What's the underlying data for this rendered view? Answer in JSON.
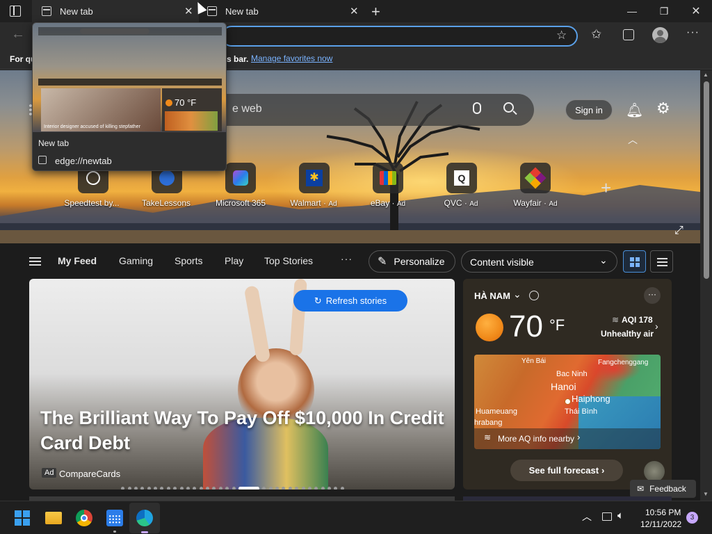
{
  "tabs": [
    {
      "label": "New tab"
    },
    {
      "label": "New tab"
    }
  ],
  "favorites_bar": {
    "prefix": "For qu",
    "suffix": "s bar.",
    "link": "Manage favorites now"
  },
  "tab_preview": {
    "title": "New tab",
    "url": "edge://newtab",
    "thumb_caption": "Interior designer accused of killing stepfather",
    "thumb_temp": "70 °F"
  },
  "search": {
    "placeholder_visible": "e web"
  },
  "header": {
    "sign_in": "Sign in"
  },
  "quick_links": [
    {
      "label": "Speedtest by...",
      "ad": ""
    },
    {
      "label": "TakeLessons",
      "ad": ""
    },
    {
      "label": "Microsoft 365",
      "ad": ""
    },
    {
      "label": "Walmart",
      "ad": "Ad"
    },
    {
      "label": "eBay",
      "ad": "Ad"
    },
    {
      "label": "QVC",
      "ad": "Ad"
    },
    {
      "label": "Wayfair",
      "ad": "Ad"
    }
  ],
  "feed_nav": {
    "items": [
      "My Feed",
      "Gaming",
      "Sports",
      "Play",
      "Top Stories"
    ],
    "more": "···",
    "personalize": "Personalize",
    "content_visible": "Content visible"
  },
  "hero_story": {
    "refresh": "Refresh stories",
    "headline": "The Brilliant Way To Pay Off $10,000 In Credit Card Debt",
    "ad_badge": "Ad",
    "source": "CompareCards"
  },
  "weather": {
    "location": "HÀ NAM",
    "temp": "70",
    "unit": "°F",
    "aqi": "AQI 178",
    "aqi_status": "Unhealthy air",
    "map_labels": [
      "Yên Bái",
      "Fangchenggang",
      "Bac Ninh",
      "Hanoi",
      "Haiphong",
      "Huameuang",
      "Thái Bình",
      "hrabang"
    ],
    "more_aq": "More AQ info nearby",
    "forecast": "See full forecast"
  },
  "feedback": "Feedback",
  "taskbar": {
    "time": "10:56 PM",
    "date": "12/11/2022",
    "badge": "3"
  },
  "colors": {
    "accent_blue": "#1a73e8",
    "link_blue": "#7ab3ff",
    "sun_orange": "#f08a1a"
  }
}
